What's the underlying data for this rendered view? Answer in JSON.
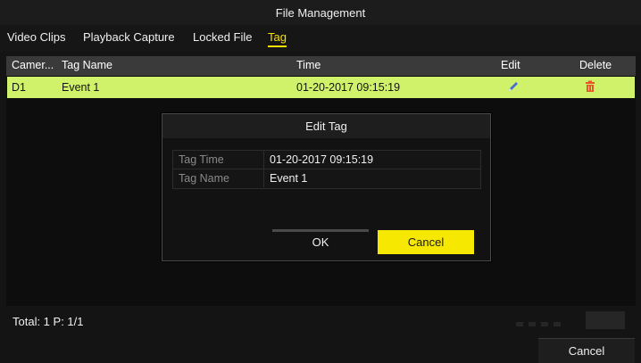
{
  "window": {
    "title": "File Management"
  },
  "tabs": [
    {
      "label": "Video Clips",
      "active": false
    },
    {
      "label": "Playback Capture",
      "active": false
    },
    {
      "label": "Locked File",
      "active": false
    },
    {
      "label": "Tag",
      "active": true
    }
  ],
  "table": {
    "headers": {
      "camera": "Camer...",
      "tag_name": "Tag Name",
      "time": "Time",
      "edit": "Edit",
      "delete": "Delete"
    },
    "rows": [
      {
        "camera": "D1",
        "tag_name": "Event 1",
        "time": "01-20-2017 09:15:19",
        "edit_icon": "pencil-icon",
        "delete_icon": "trash-icon"
      }
    ]
  },
  "footer": {
    "total": "Total: 1 P: 1/1",
    "cancel_label": "Cancel"
  },
  "dialog": {
    "title": "Edit Tag",
    "fields": [
      {
        "label": "Tag Time",
        "value": "01-20-2017 09:15:19"
      },
      {
        "label": "Tag Name",
        "value": "Event 1"
      }
    ],
    "ok_label": "OK",
    "cancel_label": "Cancel"
  },
  "colors": {
    "accent_yellow": "#f6e800",
    "selected_row": "#cff26a",
    "active_tab": "#f6e000",
    "delete_icon": "#e8552a"
  }
}
